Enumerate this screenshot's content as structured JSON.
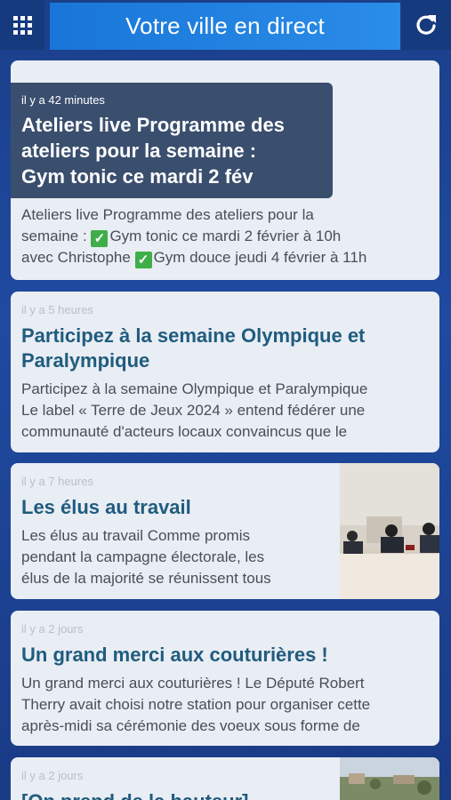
{
  "header": {
    "menu_icon": "grid-icon",
    "title": "Votre ville en direct",
    "refresh_icon": "refresh-icon"
  },
  "articles": [
    {
      "time": "il y a 42 minutes",
      "title_lines": [
        "Ateliers live Programme des",
        "ateliers pour la semaine :",
        "Gym tonic ce mardi 2 fév"
      ],
      "excerpt_lines": [
        [
          "Ateliers live Programme des ateliers pour la"
        ],
        [
          "semaine : ",
          "✓",
          "Gym tonic ce mardi 2 février à 10h"
        ],
        [
          "avec Christophe ",
          "✓",
          "Gym douce jeudi 4 février à 11h"
        ]
      ]
    },
    {
      "time": "il y a 5 heures",
      "title_lines": [
        "Participez à la semaine Olympique et",
        "Paralympique"
      ],
      "excerpt_lines": [
        "Participez à la semaine Olympique et Paralympique",
        "Le label « Terre de Jeux 2024 » entend fédérer une",
        "communauté d'acteurs locaux convaincus que le"
      ]
    },
    {
      "time": "il y a 7 heures",
      "title_lines": [
        "Les élus au travail"
      ],
      "excerpt_lines": [
        "Les élus au travail Comme promis",
        "pendant la campagne électorale, les",
        "élus de la majorité se réunissent tous"
      ]
    },
    {
      "time": "il y a 2 jours",
      "title_lines": [
        "Un grand merci aux couturières !"
      ],
      "excerpt_lines": [
        "Un grand merci aux couturières ! Le Député Robert",
        "Therry avait choisi notre station pour organiser cette",
        "après-midi sa cérémonie des voeux sous forme de"
      ]
    },
    {
      "time": "il y a 2 jours",
      "title_lines": [
        "[On prend de la hauteur]"
      ]
    }
  ],
  "colors": {
    "background": "#1f4aa0",
    "title_bar": "#2a8de8",
    "headline": "#1f5c7e",
    "overlay": "#3a4e6e",
    "check": "#3fae49"
  }
}
